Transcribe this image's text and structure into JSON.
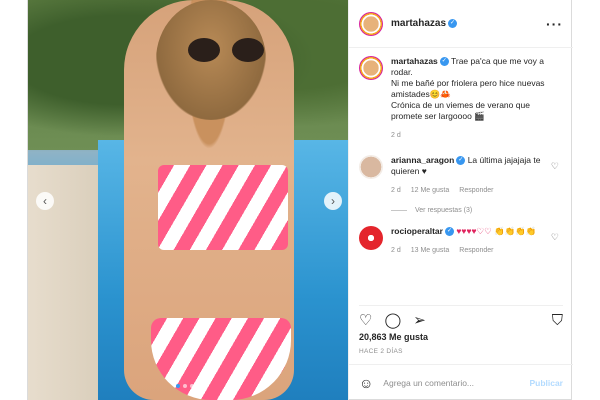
{
  "post": {
    "username": "martahazas",
    "caption": {
      "line1": "Trae pa'ca que me voy a rodar.",
      "line2": "Ni me bañé por friolera pero hice nuevas amistades😊🦀",
      "line3": "Crónica de un viemes de verano que promete ser largoooo 🎬"
    },
    "caption_time": "2 d"
  },
  "comments": [
    {
      "username": "arianna_aragon",
      "text": "La última jajajaja te quieren ♥",
      "time": "2 d",
      "likes_label": "12 Me gusta",
      "reply_label": "Responder",
      "view_replies": "Ver respuestas (3)"
    },
    {
      "username": "rocioperaltar",
      "text": "♥♥♥♥♡♡ 👏👏👏👏",
      "time": "2 d",
      "likes_label": "13 Me gusta",
      "reply_label": "Responder"
    }
  ],
  "stats": {
    "likes": "20,863 Me gusta",
    "posted": "HACE 2 DÍAS"
  },
  "composer": {
    "placeholder": "Agrega un comentario...",
    "publish_label": "Publicar"
  },
  "icons": {
    "more": "more-options-icon",
    "like": "heart-icon",
    "comment": "comment-icon",
    "share": "share-icon",
    "save": "bookmark-icon",
    "emoji": "emoji-icon",
    "verified": "verified-badge-icon"
  },
  "colors": {
    "link_blue": "#3897f0",
    "publish_disabled": "#b3dbff",
    "bikini_pink": "#ff5c87"
  }
}
